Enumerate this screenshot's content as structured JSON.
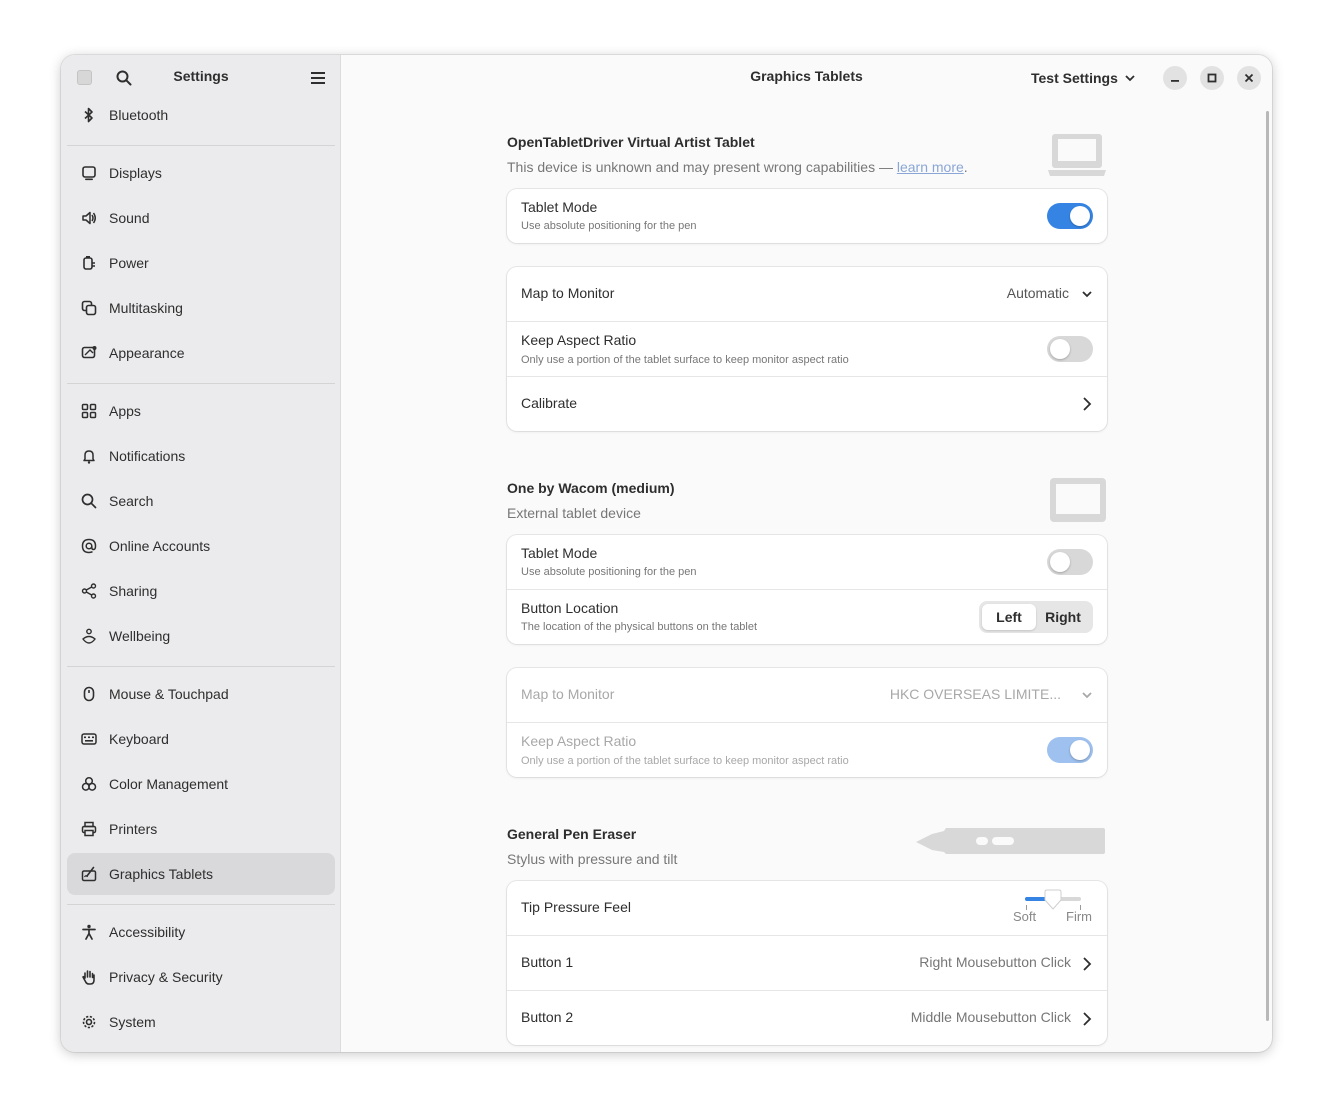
{
  "sidebar": {
    "title": "Settings",
    "items": [
      {
        "label": "Bluetooth",
        "icon": "bluetooth-icon"
      },
      {
        "label": "Displays",
        "icon": "display-icon"
      },
      {
        "label": "Sound",
        "icon": "speaker-icon"
      },
      {
        "label": "Power",
        "icon": "power-plug-icon"
      },
      {
        "label": "Multitasking",
        "icon": "multitasking-icon"
      },
      {
        "label": "Appearance",
        "icon": "appearance-icon"
      },
      {
        "label": "Apps",
        "icon": "apps-grid-icon"
      },
      {
        "label": "Notifications",
        "icon": "bell-icon"
      },
      {
        "label": "Search",
        "icon": "search-icon"
      },
      {
        "label": "Online Accounts",
        "icon": "at-sign-icon"
      },
      {
        "label": "Sharing",
        "icon": "share-icon"
      },
      {
        "label": "Wellbeing",
        "icon": "wellbeing-icon"
      },
      {
        "label": "Mouse & Touchpad",
        "icon": "mouse-icon"
      },
      {
        "label": "Keyboard",
        "icon": "keyboard-icon"
      },
      {
        "label": "Color Management",
        "icon": "color-circles-icon"
      },
      {
        "label": "Printers",
        "icon": "printer-icon"
      },
      {
        "label": "Graphics Tablets",
        "icon": "tablet-pen-icon",
        "selected": true
      },
      {
        "label": "Accessibility",
        "icon": "accessibility-person-icon"
      },
      {
        "label": "Privacy & Security",
        "icon": "hand-icon"
      },
      {
        "label": "System",
        "icon": "gear-icon"
      }
    ]
  },
  "header": {
    "title": "Graphics Tablets",
    "test_settings": "Test Settings"
  },
  "tablet1": {
    "name": "OpenTabletDriver Virtual Artist Tablet",
    "desc_prefix": "This device is unknown and may present wrong capabilities — ",
    "learn_more": "learn more",
    "desc_suffix": ".",
    "tablet_mode": {
      "title": "Tablet Mode",
      "subtitle": "Use absolute positioning for the pen",
      "on": true
    },
    "map_monitor": {
      "title": "Map to Monitor",
      "value": "Automatic"
    },
    "keep_aspect": {
      "title": "Keep Aspect Ratio",
      "subtitle": "Only use a portion of the tablet surface to keep monitor aspect ratio",
      "on": false
    },
    "calibrate": {
      "title": "Calibrate"
    }
  },
  "tablet2": {
    "name": "One by Wacom (medium)",
    "desc": "External tablet device",
    "tablet_mode": {
      "title": "Tablet Mode",
      "subtitle": "Use absolute positioning for the pen",
      "on": false
    },
    "button_location": {
      "title": "Button Location",
      "subtitle": "The location of the physical buttons on the tablet",
      "left": "Left",
      "right": "Right",
      "selected": "Left"
    },
    "map_monitor": {
      "title": "Map to Monitor",
      "value": "HKC OVERSEAS LIMITE..."
    },
    "keep_aspect": {
      "title": "Keep Aspect Ratio",
      "subtitle": "Only use a portion of the tablet surface to keep monitor aspect ratio",
      "on": true
    }
  },
  "pen": {
    "name": "General Pen Eraser",
    "desc": "Stylus with pressure and tilt",
    "tip_pressure": {
      "title": "Tip Pressure Feel",
      "soft": "Soft",
      "firm": "Firm",
      "level": 0.5
    },
    "button1": {
      "title": "Button 1",
      "value": "Right Mousebutton Click"
    },
    "button2": {
      "title": "Button 2",
      "value": "Middle Mousebutton Click"
    }
  },
  "colors": {
    "accent": "#3584e4",
    "selected_bg": "#d9d9db",
    "link": "#8aa6d6"
  }
}
